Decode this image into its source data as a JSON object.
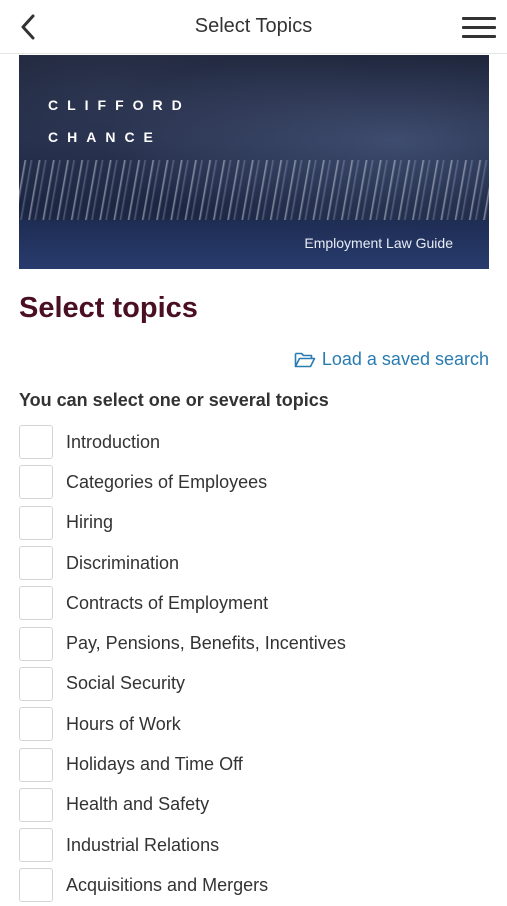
{
  "header": {
    "title": "Select Topics",
    "back_icon": "chevron-left-icon",
    "menu_icon": "hamburger-menu-icon"
  },
  "banner": {
    "brand_line1": "CLIFFORD",
    "brand_line2": "CHANCE",
    "caption": "Employment Law Guide"
  },
  "main": {
    "heading": "Select topics",
    "load_saved_search": "Load a saved search",
    "load_saved_icon": "folder-open-icon",
    "instruction": "You can select one or several topics",
    "topics": [
      {
        "label": "Introduction",
        "checked": false
      },
      {
        "label": "Categories of Employees",
        "checked": false
      },
      {
        "label": "Hiring",
        "checked": false
      },
      {
        "label": "Discrimination",
        "checked": false
      },
      {
        "label": "Contracts of Employment",
        "checked": false
      },
      {
        "label": "Pay, Pensions, Benefits, Incentives",
        "checked": false
      },
      {
        "label": "Social Security",
        "checked": false
      },
      {
        "label": "Hours of Work",
        "checked": false
      },
      {
        "label": "Holidays and Time Off",
        "checked": false
      },
      {
        "label": "Health and Safety",
        "checked": false
      },
      {
        "label": "Industrial Relations",
        "checked": false
      },
      {
        "label": "Acquisitions and Mergers",
        "checked": false
      }
    ]
  },
  "colors": {
    "heading": "#4a0f22",
    "link": "#2a7cb0",
    "text": "#333333"
  }
}
